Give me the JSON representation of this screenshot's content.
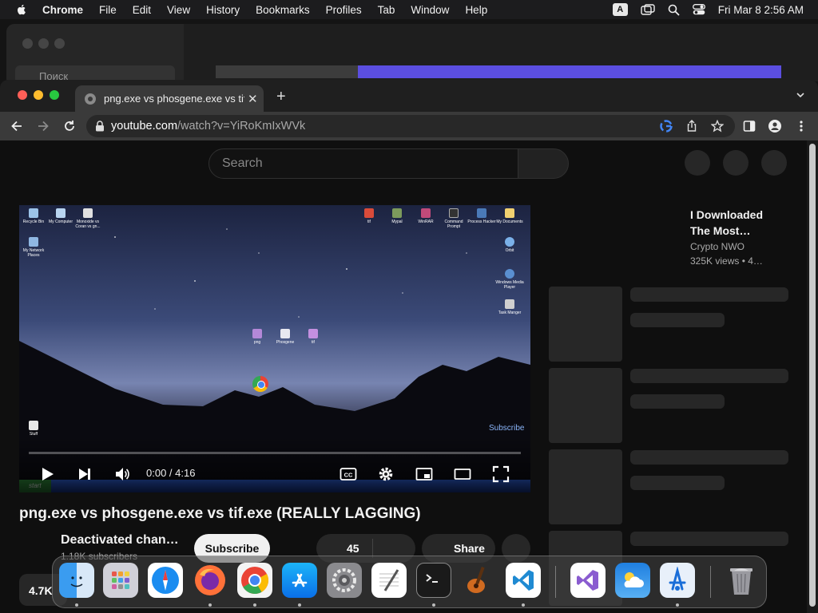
{
  "menubar": {
    "app": "Chrome",
    "items": [
      "File",
      "Edit",
      "View",
      "History",
      "Bookmarks",
      "Profiles",
      "Tab",
      "Window",
      "Help"
    ],
    "input_indicator": "A",
    "clock": "Fri Mar 8  2:56 AM"
  },
  "background_window": {
    "search_placeholder": "Поиск"
  },
  "browser": {
    "tab_title": "png.exe vs phosgene.exe vs tif.exe (REALLY LAGGING) - YouTube",
    "url_host": "youtube.com",
    "url_path": "/watch?v=YiRoKmIxWVk"
  },
  "youtube": {
    "search_placeholder": "Search",
    "video": {
      "title": "png.exe vs phosgene.exe vs tif.exe (REALLY LAGGING)",
      "time": "0:00 / 4:16",
      "watermark": "Subscribe",
      "taskbar_start": "start"
    },
    "channel": {
      "name": "Deactivated chan…",
      "subscribers": "1.18K subscribers"
    },
    "subscribe_label": "Subscribe",
    "like_count": "45",
    "share_label": "Share",
    "views_short": "4.7K",
    "recommendation": {
      "title": "I Downloaded The Most…",
      "channel": "Crypto NWO",
      "views": "325K views  • 4…"
    }
  },
  "desktop_icons": [
    {
      "label": "Recycle Bin",
      "color": "#9cc3e8"
    },
    {
      "label": "My Computer",
      "color": "#b8d4f0"
    },
    {
      "label": "Monoxide vs Coran vs gn...",
      "color": "#e0e0e0"
    },
    {
      "label": "My Network Places",
      "color": "#8fb7e2"
    },
    {
      "label": "tif",
      "color": "#d94b3a"
    },
    {
      "label": "Mypal",
      "color": "#7c9a5c"
    },
    {
      "label": "WinRAR",
      "color": "#c04a7a"
    },
    {
      "label": "Command Prompt",
      "color": "#333"
    },
    {
      "label": "Process Hacker",
      "color": "#4a7ab8"
    },
    {
      "label": "My Documents",
      "color": "#f0d070"
    },
    {
      "label": "Orbit",
      "color": "#7ab0e8"
    },
    {
      "label": "Windows Media Player",
      "color": "#5a8fd0"
    },
    {
      "label": "Task Manger",
      "color": "#d0d0d0"
    },
    {
      "label": "png",
      "color": "#b488d8"
    },
    {
      "label": "Phosgene",
      "color": "#e8e8f0"
    },
    {
      "label": "tif",
      "color": "#c490e0"
    },
    {
      "label": "Stuff",
      "color": "#e8e8e8"
    }
  ],
  "dock_apps": [
    "finder",
    "launchpad",
    "safari",
    "firefox",
    "chrome",
    "app-store",
    "system-settings",
    "textedit",
    "terminal",
    "garageband",
    "vscode",
    "visual-studio",
    "weather",
    "xcode-instruments",
    "trash"
  ]
}
